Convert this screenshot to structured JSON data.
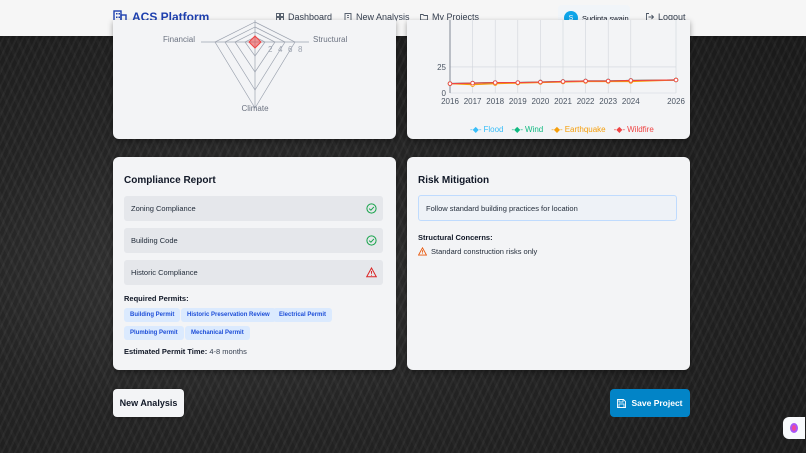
{
  "navbar": {
    "brand": "ACS Platform",
    "links": [
      {
        "label": "Dashboard",
        "icon": "grid-icon"
      },
      {
        "label": "New Analysis",
        "icon": "building-icon"
      },
      {
        "label": "My Projects",
        "icon": "folder-icon"
      }
    ],
    "user": {
      "initial": "S",
      "name": "Sudipta swain"
    },
    "logout": "Logout"
  },
  "radar": {
    "labels": {
      "left": "Financial",
      "right": "Structural",
      "bottom": "Climate"
    },
    "ring_ticks": [
      "2",
      "4",
      "6",
      "8"
    ]
  },
  "trend_chart": {
    "y_ticks": [
      "25",
      "0"
    ],
    "legend": [
      {
        "name": "Flood",
        "color": "#38bdf8"
      },
      {
        "name": "Wind",
        "color": "#10b981"
      },
      {
        "name": "Earthquake",
        "color": "#f59e0b"
      },
      {
        "name": "Wildfire",
        "color": "#ef4444"
      }
    ]
  },
  "chart_data": {
    "type": "line",
    "x": [
      2016,
      2017,
      2018,
      2019,
      2020,
      2021,
      2022,
      2023,
      2024,
      2026
    ],
    "x_tick_labels": [
      "2016",
      "2017",
      "2018",
      "2019",
      "2020",
      "2021",
      "2022",
      "2023",
      "2024",
      "2026"
    ],
    "ylim": [
      0,
      70
    ],
    "series": [
      {
        "name": "Flood",
        "values": [
          9,
          9.5,
          10,
          10,
          10.5,
          11,
          11.5,
          11.5,
          12,
          12.5
        ]
      },
      {
        "name": "Wind",
        "values": [
          9,
          9.5,
          10,
          10,
          10.5,
          11,
          11.5,
          11.5,
          12,
          12.5
        ]
      },
      {
        "name": "Earthquake",
        "values": [
          9,
          8,
          9,
          9.5,
          10,
          10.5,
          11,
          11,
          11,
          12.5
        ]
      },
      {
        "name": "Wildfire",
        "values": [
          9,
          9.5,
          10,
          10,
          10.5,
          11,
          11.5,
          11.5,
          12,
          12.5
        ]
      }
    ]
  },
  "compliance": {
    "title": "Compliance Report",
    "items": [
      {
        "label": "Zoning Compliance",
        "status": "ok"
      },
      {
        "label": "Building Code",
        "status": "ok"
      },
      {
        "label": "Historic Compliance",
        "status": "warning"
      }
    ],
    "permits_label": "Required Permits:",
    "permits": [
      "Building Permit",
      "Historic Preservation Review",
      "Electrical Permit",
      "Plumbing Permit",
      "Mechanical Permit"
    ],
    "time_label": "Estimated Permit Time:",
    "time_value": " 4-8 months"
  },
  "mitigation": {
    "title": "Risk Mitigation",
    "recommendation": "Follow standard building practices for location",
    "concerns_label": "Structural Concerns:",
    "concern": "Standard construction risks only"
  },
  "actions": {
    "new_analysis": "New Analysis",
    "save_project": "Save Project"
  },
  "colors": {
    "brand": "#1e40af",
    "primary": "#0284c7",
    "ok": "#16a34a",
    "warning": "#dc2626",
    "badge_bg": "#dbeafe"
  }
}
